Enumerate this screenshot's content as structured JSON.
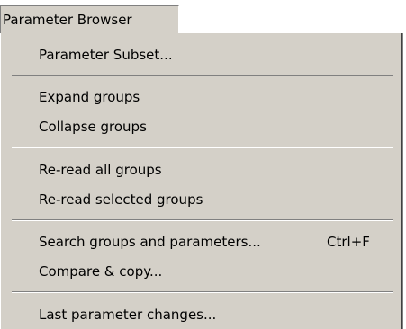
{
  "menubar": {
    "title": "Parameter Browser"
  },
  "menu": {
    "items": [
      {
        "label": "Parameter Subset...",
        "shortcut": ""
      },
      {
        "label": "Expand groups",
        "shortcut": ""
      },
      {
        "label": "Collapse groups",
        "shortcut": ""
      },
      {
        "label": "Re-read all groups",
        "shortcut": ""
      },
      {
        "label": "Re-read selected groups",
        "shortcut": ""
      },
      {
        "label": "Search groups and parameters...",
        "shortcut": "Ctrl+F"
      },
      {
        "label": "Compare & copy...",
        "shortcut": ""
      },
      {
        "label": "Last parameter changes...",
        "shortcut": ""
      }
    ]
  }
}
